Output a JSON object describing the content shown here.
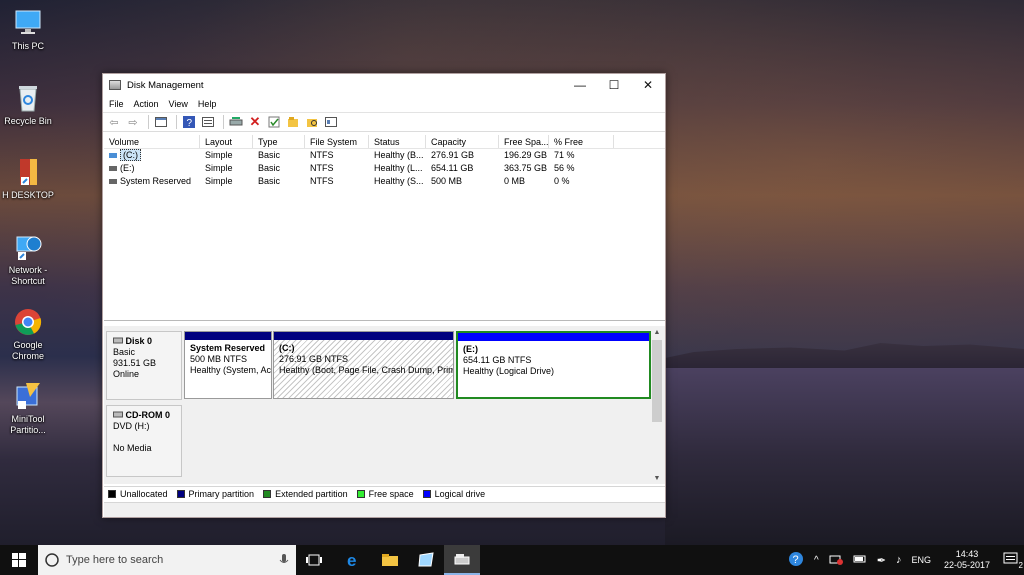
{
  "desktop": {
    "icons": [
      {
        "label": "This PC"
      },
      {
        "label": "Recycle Bin"
      },
      {
        "label": "H DESKTOP"
      },
      {
        "label": "Network - Shortcut"
      },
      {
        "label": "Google Chrome"
      },
      {
        "label": "MiniTool Partitio..."
      }
    ]
  },
  "window": {
    "title": "Disk Management",
    "controls": {
      "minimize": "—",
      "maximize": "☐",
      "close": "✕"
    }
  },
  "menu": [
    "File",
    "Action",
    "View",
    "Help"
  ],
  "volumes": {
    "headers": [
      "Volume",
      "Layout",
      "Type",
      "File System",
      "Status",
      "Capacity",
      "Free Spa...",
      "% Free"
    ],
    "rows": [
      {
        "volume": "(C:)",
        "layout": "Simple",
        "type": "Basic",
        "fs": "NTFS",
        "status": "Healthy (B...",
        "capacity": "276.91 GB",
        "free": "196.29 GB",
        "pct": "71 %"
      },
      {
        "volume": "(E:)",
        "layout": "Simple",
        "type": "Basic",
        "fs": "NTFS",
        "status": "Healthy (L...",
        "capacity": "654.11 GB",
        "free": "363.75 GB",
        "pct": "56 %"
      },
      {
        "volume": "System Reserved",
        "layout": "Simple",
        "type": "Basic",
        "fs": "NTFS",
        "status": "Healthy (S...",
        "capacity": "500 MB",
        "free": "0 MB",
        "pct": "0 %"
      }
    ]
  },
  "disks": {
    "disk0": {
      "name": "Disk 0",
      "kind": "Basic",
      "size": "931.51 GB",
      "state": "Online"
    },
    "cdrom0": {
      "name": "CD-ROM 0",
      "kind": "DVD (H:)",
      "state": "No Media"
    },
    "partitions": [
      {
        "name": "System Reserved",
        "size": "500 MB NTFS",
        "status": "Healthy (System, Ac"
      },
      {
        "name": "(C:)",
        "size": "276.91 GB NTFS",
        "status": "Healthy (Boot, Page File, Crash Dump, Prim"
      },
      {
        "name": "(E:)",
        "size": "654.11 GB NTFS",
        "status": "Healthy (Logical Drive)"
      }
    ]
  },
  "legend": [
    {
      "label": "Unallocated",
      "color": "#000000"
    },
    {
      "label": "Primary partition",
      "color": "#00007f"
    },
    {
      "label": "Extended partition",
      "color": "#218a21"
    },
    {
      "label": "Free space",
      "color": "#33ee33"
    },
    {
      "label": "Logical drive",
      "color": "#0000ff"
    }
  ],
  "taskbar": {
    "search_placeholder": "Type here to search",
    "tray": {
      "lang": "ENG",
      "time": "14:43",
      "date": "22-05-2017",
      "notifications": "2"
    }
  }
}
